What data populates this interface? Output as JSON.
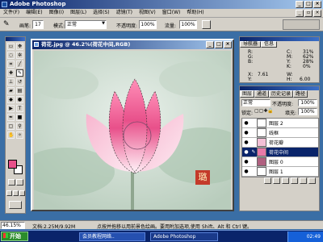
{
  "app": {
    "title": "Adobe Photoshop"
  },
  "menu": [
    "文件(F)",
    "编辑(E)",
    "图像(I)",
    "图层(L)",
    "选择(S)",
    "滤镜(T)",
    "视图(V)",
    "窗口(W)",
    "帮助(H)"
  ],
  "options_bar": {
    "brush_label": "画笔:",
    "brush_size": "17",
    "mode_label": "模式:",
    "mode_value": "正常",
    "opacity_label": "不透明度:",
    "opacity_value": "100%",
    "flow_label": "流量:",
    "flow_value": "100%"
  },
  "document": {
    "title": "荷花.jpg @ 46.2%(荷花中间,RGB)",
    "seal_text": "璐"
  },
  "nav_panel": {
    "tabs": [
      "导航器",
      "信息"
    ],
    "rows": [
      {
        "k": "R:",
        "v": "",
        "k2": "C:",
        "v2": "31%"
      },
      {
        "k": "G:",
        "v": "",
        "k2": "M:",
        "v2": "62%"
      },
      {
        "k": "B:",
        "v": "",
        "k2": "Y:",
        "v2": "28%"
      },
      {
        "k": "",
        "v": "",
        "k2": "K:",
        "v2": "0%"
      }
    ],
    "x_label": "X:",
    "x_value": "7.61",
    "y_label": "Y:",
    "y_value": "",
    "w_label": "W:",
    "w_value": "",
    "h_label": "H:",
    "h_value": "6.00"
  },
  "layers_panel": {
    "tabs": [
      "图层",
      "通道",
      "历史记录",
      "路径"
    ],
    "blend_mode": "正常",
    "opacity_label": "不透明度:",
    "opacity_value": "100%",
    "lock_label": "锁定:",
    "fill_label": "填充:",
    "fill_value": "100%",
    "layers": [
      {
        "name": "图层 2",
        "selected": false,
        "thumb": "#ffffff"
      },
      {
        "name": "线框",
        "selected": false,
        "thumb": "#ffffff"
      },
      {
        "name": "荷花瓣",
        "selected": false,
        "thumb": "#f3c0d6"
      },
      {
        "name": "荷花中间",
        "selected": true,
        "thumb": "#e87aa8"
      },
      {
        "name": "图层 0",
        "selected": false,
        "thumb": "#b06080"
      },
      {
        "name": "图层 1",
        "selected": false,
        "thumb": "#ffffff"
      }
    ]
  },
  "status_bar": {
    "zoom": "46.15%",
    "doc_size": "文档:2.25M/9.92M",
    "hint": "点按并拖移以用前景色绘画。要用附加选项,使用 Shift、Alt 和 Ctrl 键。"
  },
  "taskbar": {
    "start": "开始",
    "items": [
      "会员教程网络..",
      "Adobe Photoshop"
    ],
    "clock": "02:49"
  },
  "colors": {
    "desktop": "#3a6ea5",
    "chrome": "#d4d0c8",
    "titlebar": "#0a246a",
    "selection": "#0a246a",
    "petal": "#e8508a"
  },
  "icons": [
    "photoshop-logo-icon",
    "brush-icon",
    "eye-icon",
    "lock-icon",
    "windows-flag-icon"
  ]
}
